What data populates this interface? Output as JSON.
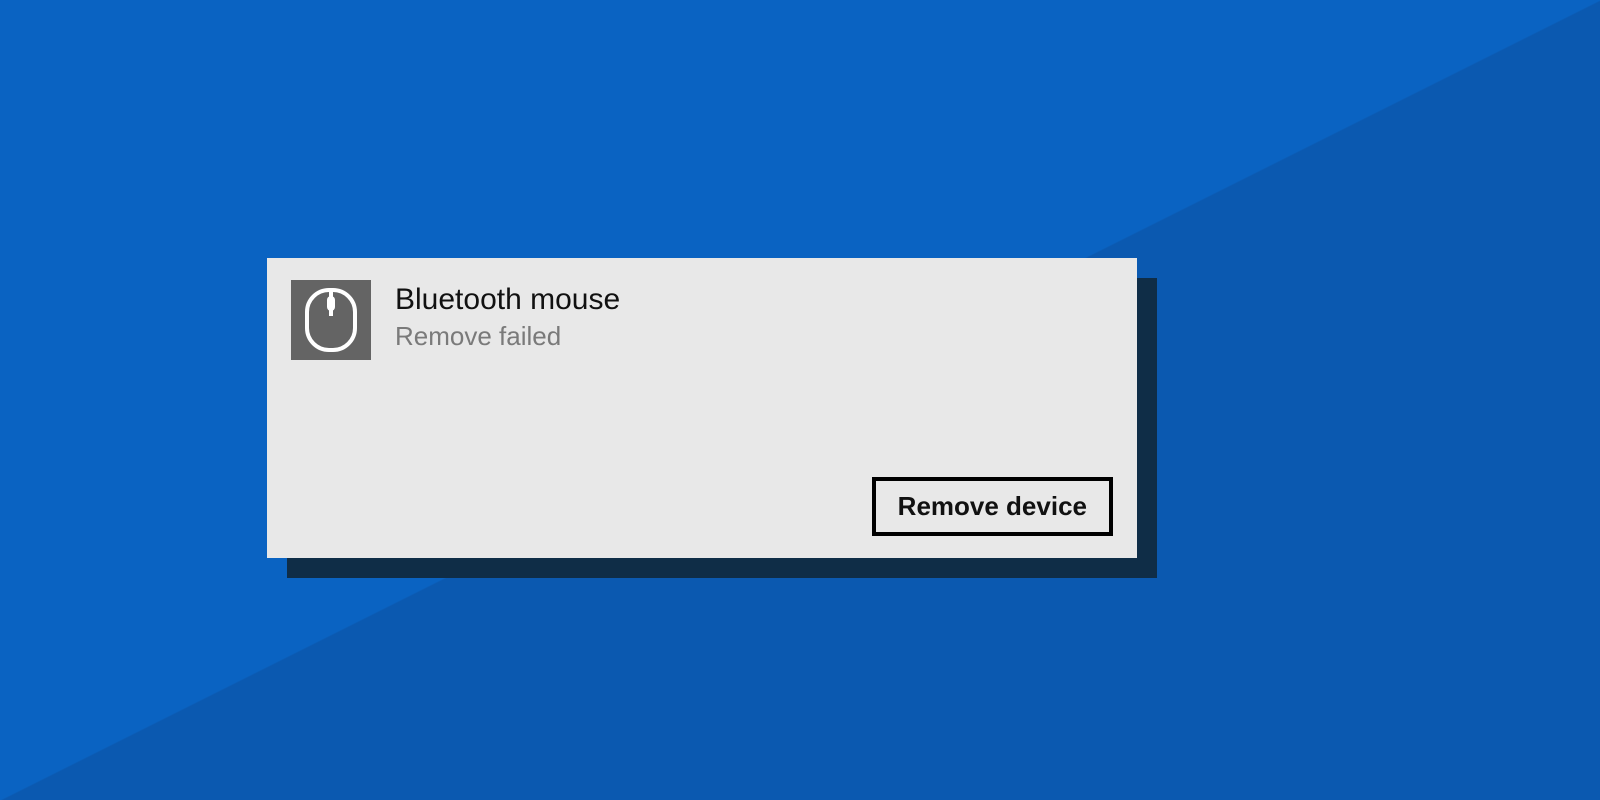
{
  "colors": {
    "bg_primary": "#0a63c2",
    "bg_secondary": "#0b59b0",
    "panel": "#e8e8e8",
    "panel_shadow": "#0f2d47",
    "icon_box": "#646464",
    "text_primary": "#111111",
    "text_muted": "#7a7a7a",
    "button_border": "#000000"
  },
  "device": {
    "icon": "mouse-icon",
    "name": "Bluetooth mouse",
    "status": "Remove failed"
  },
  "actions": {
    "remove_label": "Remove device"
  }
}
